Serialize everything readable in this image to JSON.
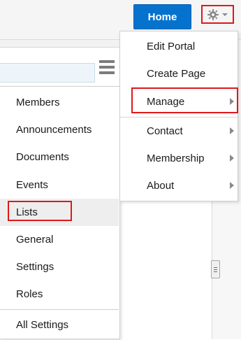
{
  "header": {
    "home_label": "Home",
    "settings_icon": "gear-icon",
    "settings_dropdown_icon": "caret-down-icon"
  },
  "colors": {
    "primary": "#0572ce",
    "highlight": "#e0181b",
    "menu_text": "#1a1a1a"
  },
  "gear_menu": {
    "items": [
      {
        "label": "Edit Portal",
        "has_submenu": false
      },
      {
        "label": "Create Page",
        "has_submenu": false
      },
      {
        "label": "Manage",
        "has_submenu": true
      },
      {
        "label": "Contact",
        "has_submenu": true
      },
      {
        "label": "Membership",
        "has_submenu": true
      },
      {
        "label": "About",
        "has_submenu": true
      }
    ]
  },
  "manage_menu": {
    "items": [
      {
        "label": "Members"
      },
      {
        "label": "Announcements"
      },
      {
        "label": "Documents"
      },
      {
        "label": "Events"
      },
      {
        "label": "Lists"
      },
      {
        "label": "General"
      },
      {
        "label": "Settings"
      },
      {
        "label": "Roles"
      },
      {
        "label": "All Settings"
      }
    ]
  }
}
